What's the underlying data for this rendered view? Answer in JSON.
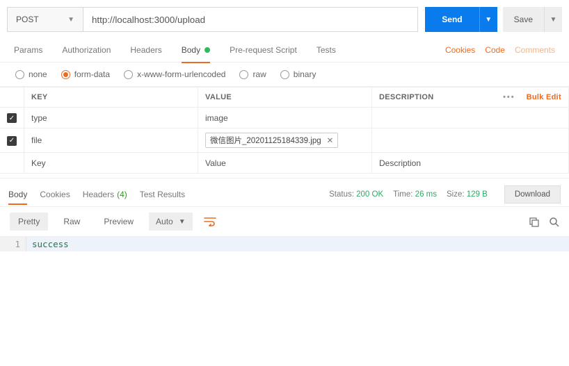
{
  "request": {
    "method": "POST",
    "url": "http://localhost:3000/upload",
    "send_label": "Send",
    "save_label": "Save"
  },
  "req_tabs": {
    "items": [
      "Params",
      "Authorization",
      "Headers",
      "Body",
      "Pre-request Script",
      "Tests"
    ],
    "active_index": 3,
    "right_links": [
      "Cookies",
      "Code",
      "Comments"
    ]
  },
  "body_types": [
    "none",
    "form-data",
    "x-www-form-urlencoded",
    "raw",
    "binary"
  ],
  "body_type_selected": 1,
  "form_table": {
    "headers": {
      "key": "KEY",
      "value": "VALUE",
      "desc": "DESCRIPTION"
    },
    "bulk_edit": "Bulk Edit",
    "rows": [
      {
        "checked": true,
        "key": "type",
        "value_text": "image",
        "desc": ""
      },
      {
        "checked": true,
        "key": "file",
        "file_name": "微信图片_20201125184339.jpg",
        "desc": ""
      }
    ],
    "placeholders": {
      "key": "Key",
      "value": "Value",
      "desc": "Description"
    }
  },
  "resp_tabs": {
    "items": [
      {
        "label": "Body"
      },
      {
        "label": "Cookies"
      },
      {
        "label": "Headers",
        "count": "(4)"
      },
      {
        "label": "Test Results"
      }
    ],
    "active_index": 0
  },
  "stats": {
    "status_label": "Status:",
    "status_value": "200 OK",
    "time_label": "Time:",
    "time_value": "26 ms",
    "size_label": "Size:",
    "size_value": "129 B",
    "download": "Download"
  },
  "viewer": {
    "modes": [
      "Pretty",
      "Raw",
      "Preview"
    ],
    "active_mode": 0,
    "format": "Auto"
  },
  "response_body": {
    "lines": [
      {
        "n": "1",
        "text": "success"
      }
    ]
  }
}
